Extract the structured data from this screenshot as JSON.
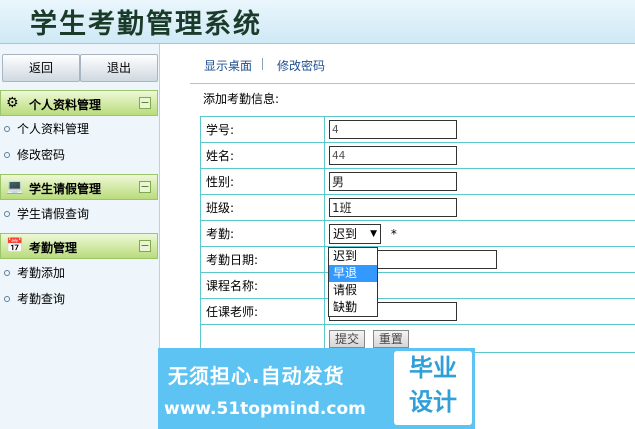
{
  "app": {
    "title": "学生考勤管理系统"
  },
  "sidebar": {
    "back_label": "返回",
    "quit_label": "退出",
    "sections": [
      {
        "icon": "gear-icon",
        "title": "个人资料管理",
        "collapse": "−",
        "items": [
          "个人资料管理",
          "修改密码"
        ]
      },
      {
        "icon": "computer-icon",
        "title": "学生请假管理",
        "collapse": "−",
        "items": [
          "学生请假查询"
        ]
      },
      {
        "icon": "calendar-icon",
        "title": "考勤管理",
        "collapse": "−",
        "items": [
          "考勤添加",
          "考勤查询"
        ]
      }
    ]
  },
  "topnav": {
    "show_desktop": "显示桌面",
    "change_password": "修改密码"
  },
  "form": {
    "title": "添加考勤信息:",
    "fields": {
      "student_id": {
        "label": "学号:",
        "value": "4"
      },
      "name": {
        "label": "姓名:",
        "value": "44"
      },
      "gender": {
        "label": "性别:",
        "value": "男"
      },
      "class": {
        "label": "班级:",
        "value": "1班"
      },
      "attendance": {
        "label": "考勤:",
        "value": "迟到",
        "required_mark": "*",
        "options": [
          "迟到",
          "早退",
          "请假",
          "缺勤"
        ],
        "highlighted": "早退"
      },
      "date": {
        "label": "考勤日期:",
        "value": ""
      },
      "course": {
        "label": "课程名称:",
        "value": ""
      },
      "teacher": {
        "label": "任课老师:",
        "value": ""
      }
    },
    "submit_label": "提交",
    "reset_label": "重置"
  },
  "watermark": {
    "line1": "无须担心.自动发货",
    "line2": "www.51topmind.com",
    "badge_top": "毕业",
    "badge_bottom": "设计"
  },
  "colors": {
    "header_bg": "#cfe9f6",
    "section_head": "#b9dc7c",
    "table_border": "#5cc8cc",
    "watermark_bg": "#5dc3f2",
    "highlight": "#3399ff"
  }
}
